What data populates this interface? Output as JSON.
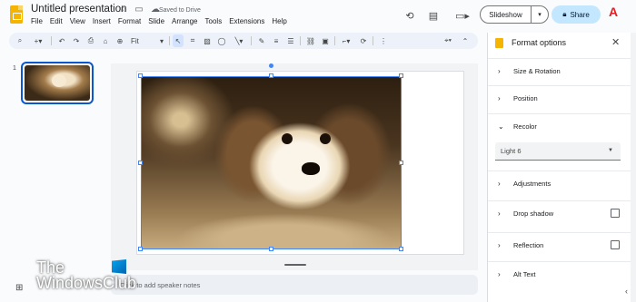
{
  "header": {
    "title": "Untitled presentation",
    "saved_status": "Saved to Drive",
    "menu": [
      "File",
      "Edit",
      "View",
      "Insert",
      "Format",
      "Slide",
      "Arrange",
      "Tools",
      "Extensions",
      "Help"
    ],
    "slideshow_label": "Slideshow",
    "share_label": "Share"
  },
  "toolbar": {
    "zoom_value": "Fit"
  },
  "slides_panel": {
    "slide_number": "1"
  },
  "notes": {
    "placeholder": "Click to add speaker notes"
  },
  "watermark": {
    "line1": "The",
    "line2": "WindowsClub"
  },
  "format_panel": {
    "title": "Format options",
    "sections": {
      "size_rotation": "Size & Rotation",
      "position": "Position",
      "recolor": "Recolor",
      "adjustments": "Adjustments",
      "drop_shadow": "Drop shadow",
      "reflection": "Reflection",
      "alt_text": "Alt Text"
    },
    "recolor_value": "Light 6"
  },
  "colors": {
    "accent": "#0b57d0",
    "share_bg": "#c2e7ff",
    "slides_yellow": "#f4b400",
    "selection": "#4285f4"
  },
  "icons": [
    "slides-logo-icon",
    "star-icon",
    "move-to-folder-icon",
    "cloud-saved-icon",
    "history-icon",
    "comment-icon",
    "video-call-icon",
    "lock-icon",
    "acrobat-icon",
    "search-icon",
    "zoom-in-icon",
    "undo-icon",
    "redo-icon",
    "print-icon",
    "paint-format-icon",
    "select-icon",
    "frame-icon",
    "image-icon",
    "shape-icon",
    "line-icon",
    "pen-icon",
    "border-weight-icon",
    "border-dash-icon",
    "link-icon",
    "alt-text-icon",
    "crop-icon",
    "reset-image-icon",
    "more-icon",
    "pen-tool-icon",
    "chevron-up-icon",
    "close-icon",
    "grid-view-icon"
  ]
}
